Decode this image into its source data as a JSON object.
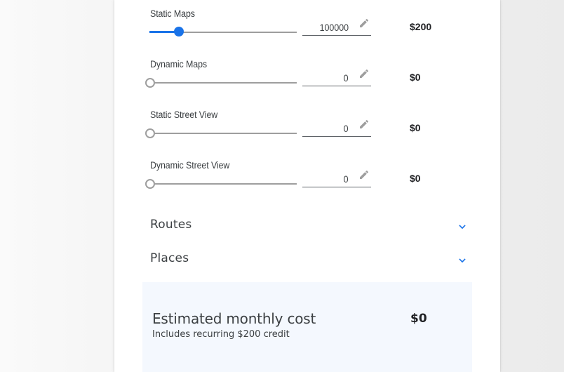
{
  "colors": {
    "accent": "#1a73e8",
    "track_inactive": "#9e9e9e",
    "estimate_background": "#f4f8fe"
  },
  "apis": [
    {
      "label": "Static Maps",
      "value": "100000",
      "price": "$200",
      "slider_fraction": 0.2,
      "active": true
    },
    {
      "label": "Dynamic Maps",
      "value": "0",
      "price": "$0",
      "slider_fraction": 0,
      "active": false
    },
    {
      "label": "Static Street View",
      "value": "0",
      "price": "$0",
      "slider_fraction": 0,
      "active": false
    },
    {
      "label": "Dynamic Street View",
      "value": "0",
      "price": "$0",
      "slider_fraction": 0,
      "active": false
    }
  ],
  "sections": [
    {
      "title": "Routes",
      "icon": "chevron-down-icon"
    },
    {
      "title": "Places",
      "icon": "chevron-down-icon"
    }
  ],
  "estimate": {
    "title": "Estimated monthly cost",
    "subtitle": "Includes recurring $200 credit",
    "total": "$0"
  }
}
